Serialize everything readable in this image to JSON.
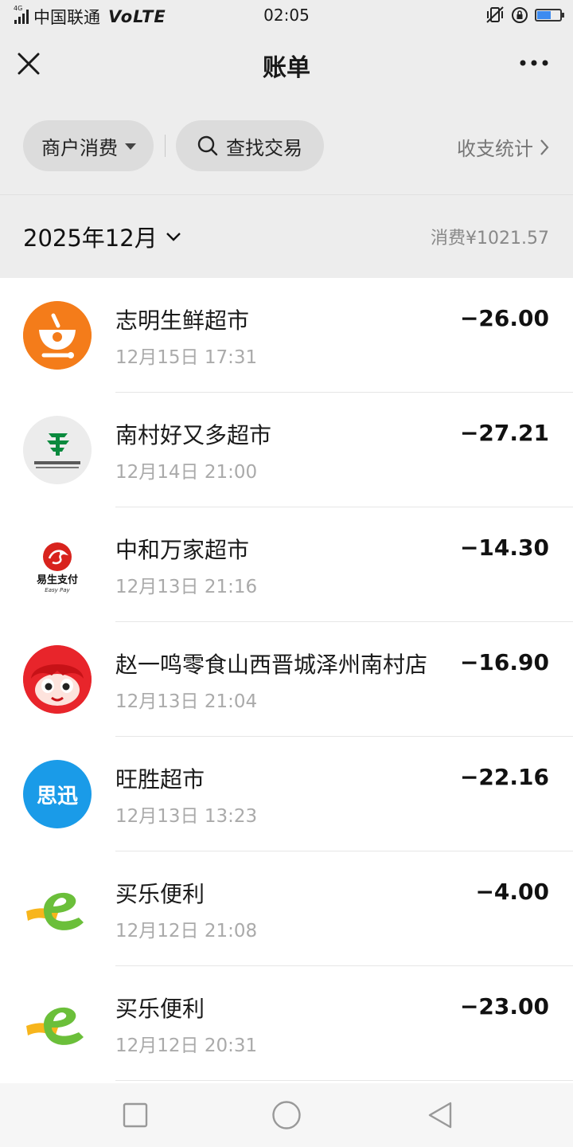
{
  "status_bar": {
    "network": "4G",
    "carrier": "中国联通",
    "volte": "VoLTE",
    "time": "02:05",
    "battery_level": 0.6
  },
  "header": {
    "title": "账单",
    "close_icon": "close-icon",
    "more_icon": "more-icon"
  },
  "filters": {
    "merchant_label": "商户消费",
    "search_label": "查找交易",
    "stats_label": "收支统计"
  },
  "month": {
    "label": "2025年12月",
    "total": "消费¥1021.57"
  },
  "transactions": [
    {
      "merchant": "志明生鲜超市",
      "time": "12月15日 17:31",
      "amount": "−26.00",
      "logo": "bowl-logo-orange"
    },
    {
      "merchant": "南村好又多超市",
      "time": "12月14日 21:00",
      "amount": "−27.21",
      "logo": "postal-bank-logo"
    },
    {
      "merchant": "中和万家超市",
      "time": "12月13日 21:16",
      "amount": "−14.30",
      "logo": "easypay-logo",
      "logo_text": "易生支付",
      "logo_subtext": "Easy Pay"
    },
    {
      "merchant": "赵一鸣零食山西晋城泽州南村店",
      "time": "12月13日 21:04",
      "amount": "−16.90",
      "logo": "mascot-logo-red"
    },
    {
      "merchant": "旺胜超市",
      "time": "12月13日 13:23",
      "amount": "−22.16",
      "logo": "sixun-logo",
      "logo_text": "思迅"
    },
    {
      "merchant": "买乐便利",
      "time": "12月12日 21:08",
      "amount": "−4.00",
      "logo": "e-logo-green"
    },
    {
      "merchant": "买乐便利",
      "time": "12月12日 20:31",
      "amount": "−23.00",
      "logo": "e-logo-green"
    }
  ],
  "colors": {
    "background": "#ededed",
    "orange": "#f5821f",
    "sixun_blue": "#1a9be8",
    "mascot_red": "#e8252b",
    "e_green": "#7cc142",
    "e_yellow": "#f7b51c"
  }
}
